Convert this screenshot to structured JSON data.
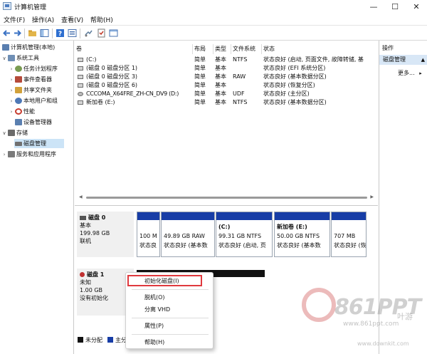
{
  "window": {
    "title": "计算机管理",
    "minimize": "—",
    "maximize": "☐",
    "close": "✕"
  },
  "menu": [
    "文件(F)",
    "操作(A)",
    "查看(V)",
    "帮助(H)"
  ],
  "tree": [
    {
      "label": "计算机管理(本地)",
      "chev": "",
      "level": 0,
      "color": "#5a7fb0"
    },
    {
      "label": "系统工具",
      "chev": "∨",
      "level": 1,
      "color": "#6f8fb5"
    },
    {
      "label": "任务计划程序",
      "chev": "›",
      "level": 2,
      "color": "#7a9c52"
    },
    {
      "label": "事件查看器",
      "chev": "›",
      "level": 2,
      "color": "#b54a3a"
    },
    {
      "label": "共享文件夹",
      "chev": "›",
      "level": 2,
      "color": "#d1a13b"
    },
    {
      "label": "本地用户和组",
      "chev": "›",
      "level": 2,
      "color": "#4d78b6"
    },
    {
      "label": "性能",
      "chev": "›",
      "level": 2,
      "color": "#c63b2e"
    },
    {
      "label": "设备管理器",
      "chev": "",
      "level": 2,
      "color": "#5a7fb0"
    },
    {
      "label": "存储",
      "chev": "∨",
      "level": 1,
      "color": "#6a6a6a"
    },
    {
      "label": "磁盘管理",
      "chev": "",
      "level": 2,
      "color": "#707070",
      "selected": true
    },
    {
      "label": "服务和应用程序",
      "chev": "›",
      "level": 1,
      "color": "#7a7a7a"
    }
  ],
  "volume_table": {
    "headers": [
      "卷",
      "布局",
      "类型",
      "文件系统",
      "状态"
    ],
    "rows": [
      [
        "(C:)",
        "简单",
        "基本",
        "NTFS",
        "状态良好 (启动, 页面文件, 故障转储, 基"
      ],
      [
        "(磁盘 0 磁盘分区 1)",
        "简单",
        "基本",
        "",
        "状态良好 (EFI 系统分区)"
      ],
      [
        "(磁盘 0 磁盘分区 3)",
        "简单",
        "基本",
        "RAW",
        "状态良好 (基本数据分区)"
      ],
      [
        "(磁盘 0 磁盘分区 6)",
        "简单",
        "基本",
        "",
        "状态良好 (恢复分区)"
      ],
      [
        "CCCOMA_X64FRE_ZH-CN_DV9 (D:)",
        "简单",
        "基本",
        "UDF",
        "状态良好 (主分区)"
      ],
      [
        "新加卷 (E:)",
        "简单",
        "基本",
        "NTFS",
        "状态良好 (基本数据分区)"
      ]
    ]
  },
  "disks": [
    {
      "name": "磁盘 0",
      "lines": [
        "基本",
        "199.98 GB",
        "联机"
      ],
      "partitions": [
        {
          "title": "",
          "size": "100 M",
          "status": "状态良"
        },
        {
          "title": "",
          "size": "49.89 GB RAW",
          "status": "状态良好 (基本数"
        },
        {
          "title": "(C:)",
          "size": "99.31 GB NTFS",
          "status": "状态良好 (启动, 页"
        },
        {
          "title": "新加卷 (E:)",
          "size": "50.00 GB NTFS",
          "status": "状态良好 (基本数"
        },
        {
          "title": "",
          "size": "707 MB",
          "status": "状态良好 (恢复"
        }
      ]
    },
    {
      "name": "磁盘 1",
      "lines": [
        "未知",
        "1.00 GB",
        "没有初始化"
      ]
    }
  ],
  "context_menu": {
    "items": [
      "初始化磁盘(I)",
      "脱机(O)",
      "分离 VHD",
      "属性(P)",
      "帮助(H)"
    ]
  },
  "legend": {
    "items": [
      "未分配",
      "主分"
    ]
  },
  "actions": {
    "header": "操作",
    "section": "磁盘管理",
    "section_arrow": "▲",
    "more": "更多...",
    "more_arrow": "▸"
  },
  "watermark": {
    "brand": "861PPT",
    "url": "www.861ppt.com",
    "url2": "www.downkit.com",
    "cn": "叶游"
  },
  "colors": {
    "partition_header": "#173da6",
    "selection": "#cce4f7",
    "highlight_border": "#e0393e",
    "legend_unallocated": "#111111",
    "legend_primary": "#173da6"
  }
}
